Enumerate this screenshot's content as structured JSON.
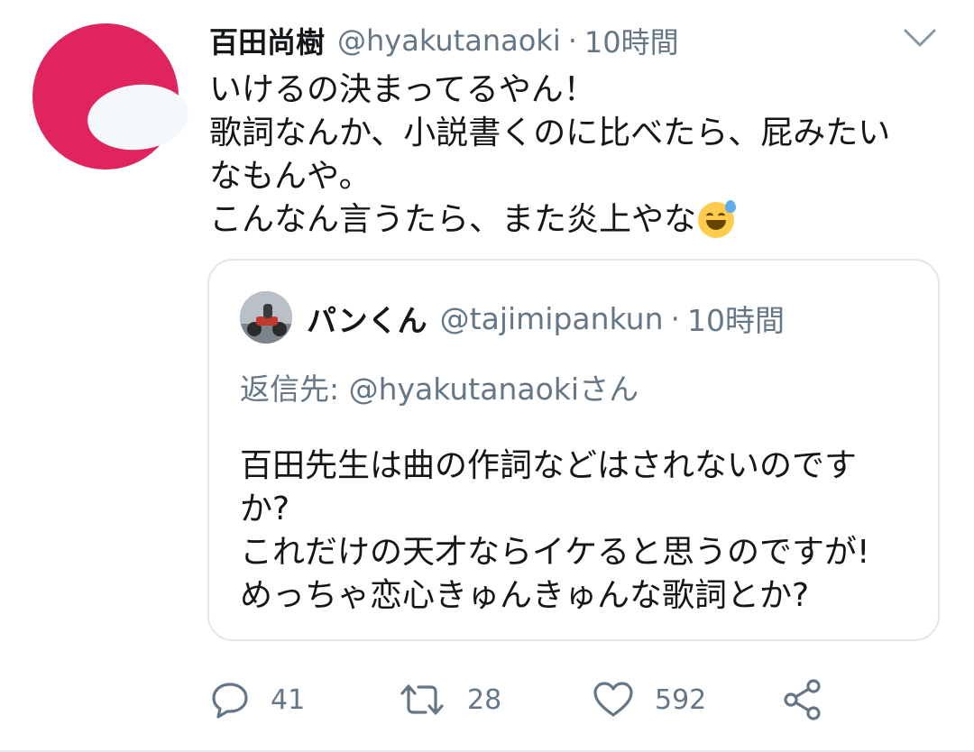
{
  "tweet": {
    "author_name": "百田尚樹",
    "author_handle": "@hyakutanaoki",
    "separator": "·",
    "time": "10時間",
    "text_lines": [
      "いけるの決まってるやん！",
      "歌詞なんか、小説書くのに比べたら、屁みたい",
      "なもんや。",
      "こんなん言うたら、また炎上やな"
    ],
    "emoji": "sweat-smile-emoji"
  },
  "quoted_tweet": {
    "author_name": "パンくん",
    "author_handle": "@tajimipankun",
    "separator": "·",
    "time": "10時間",
    "reply_prefix": "返信先: ",
    "reply_to": "@hyakutanaoki",
    "reply_suffix": "さん",
    "text_lines": [
      "百田先生は曲の作詞などはされないのです",
      "か?",
      "これだけの天才ならイケると思うのですが!",
      "めっちゃ恋心きゅんきゅんな歌詞とか?"
    ]
  },
  "actions": {
    "reply_count": "41",
    "retweet_count": "28",
    "like_count": "592"
  },
  "icons": {
    "menu": "chevron-down-icon",
    "reply": "comment-icon",
    "retweet": "retweet-icon",
    "like": "heart-icon",
    "share": "share-icon"
  },
  "colors": {
    "avatar": "#e0245e",
    "secondary_text": "#657786",
    "border": "#e1e8ed"
  }
}
